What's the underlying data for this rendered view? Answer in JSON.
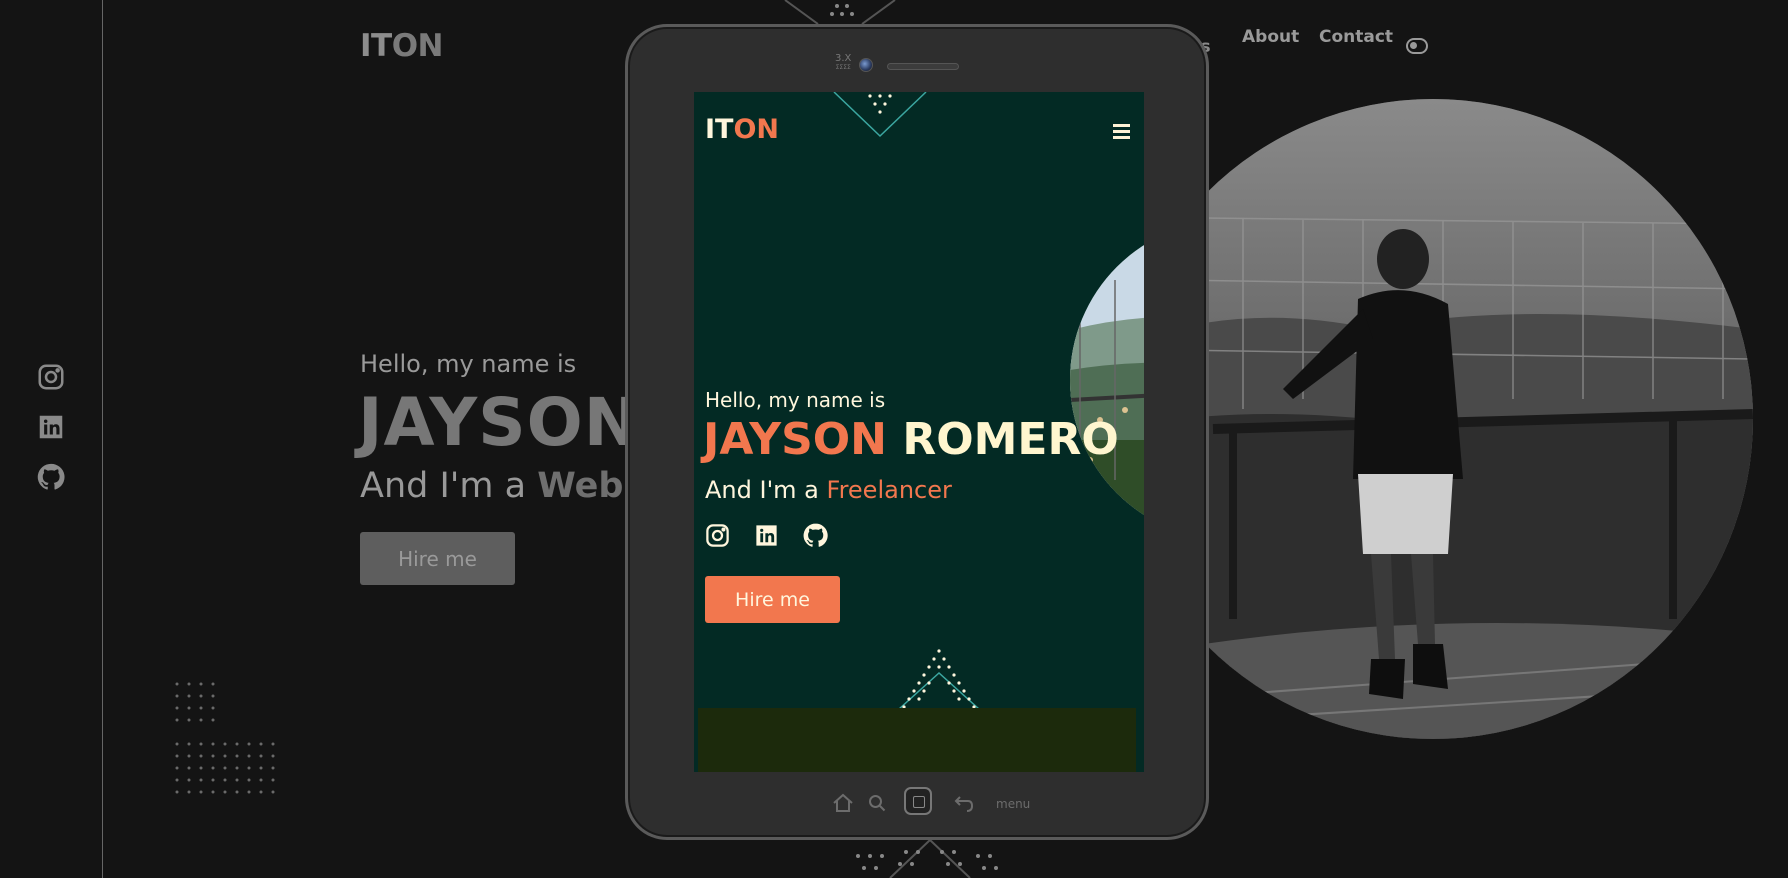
{
  "background_site": {
    "logo_part1": "IT",
    "logo_part2": "ON",
    "nav": {
      "partial_item": "es",
      "about": "About",
      "contact": "Contact"
    },
    "hello": "Hello, my name is",
    "name_visible": "JAYSON",
    "role_prefix": "And I'm a ",
    "role_accent_visible": "Web D",
    "hire_button": "Hire me",
    "social_icons": [
      "instagram-icon",
      "linkedin-icon",
      "github-icon"
    ]
  },
  "tablet": {
    "brand_line1": "3.X",
    "brand_line2": "ΣΣΣΣ",
    "menu_label": "menu",
    "screen": {
      "logo_part1": "IT",
      "logo_part2": "ON",
      "hello": "Hello, my name is",
      "first_name": "JAYSON",
      "last_name": "ROMERO",
      "role_prefix": "And I'm a ",
      "role_accent": "Freelancer",
      "hire_button": "Hire me",
      "social_icons": [
        "instagram-icon",
        "linkedin-icon",
        "github-icon"
      ]
    }
  },
  "colors": {
    "page_bg": "#141414",
    "screen_bg": "#032a24",
    "accent": "#f2774e",
    "cream": "#fff6dd"
  }
}
